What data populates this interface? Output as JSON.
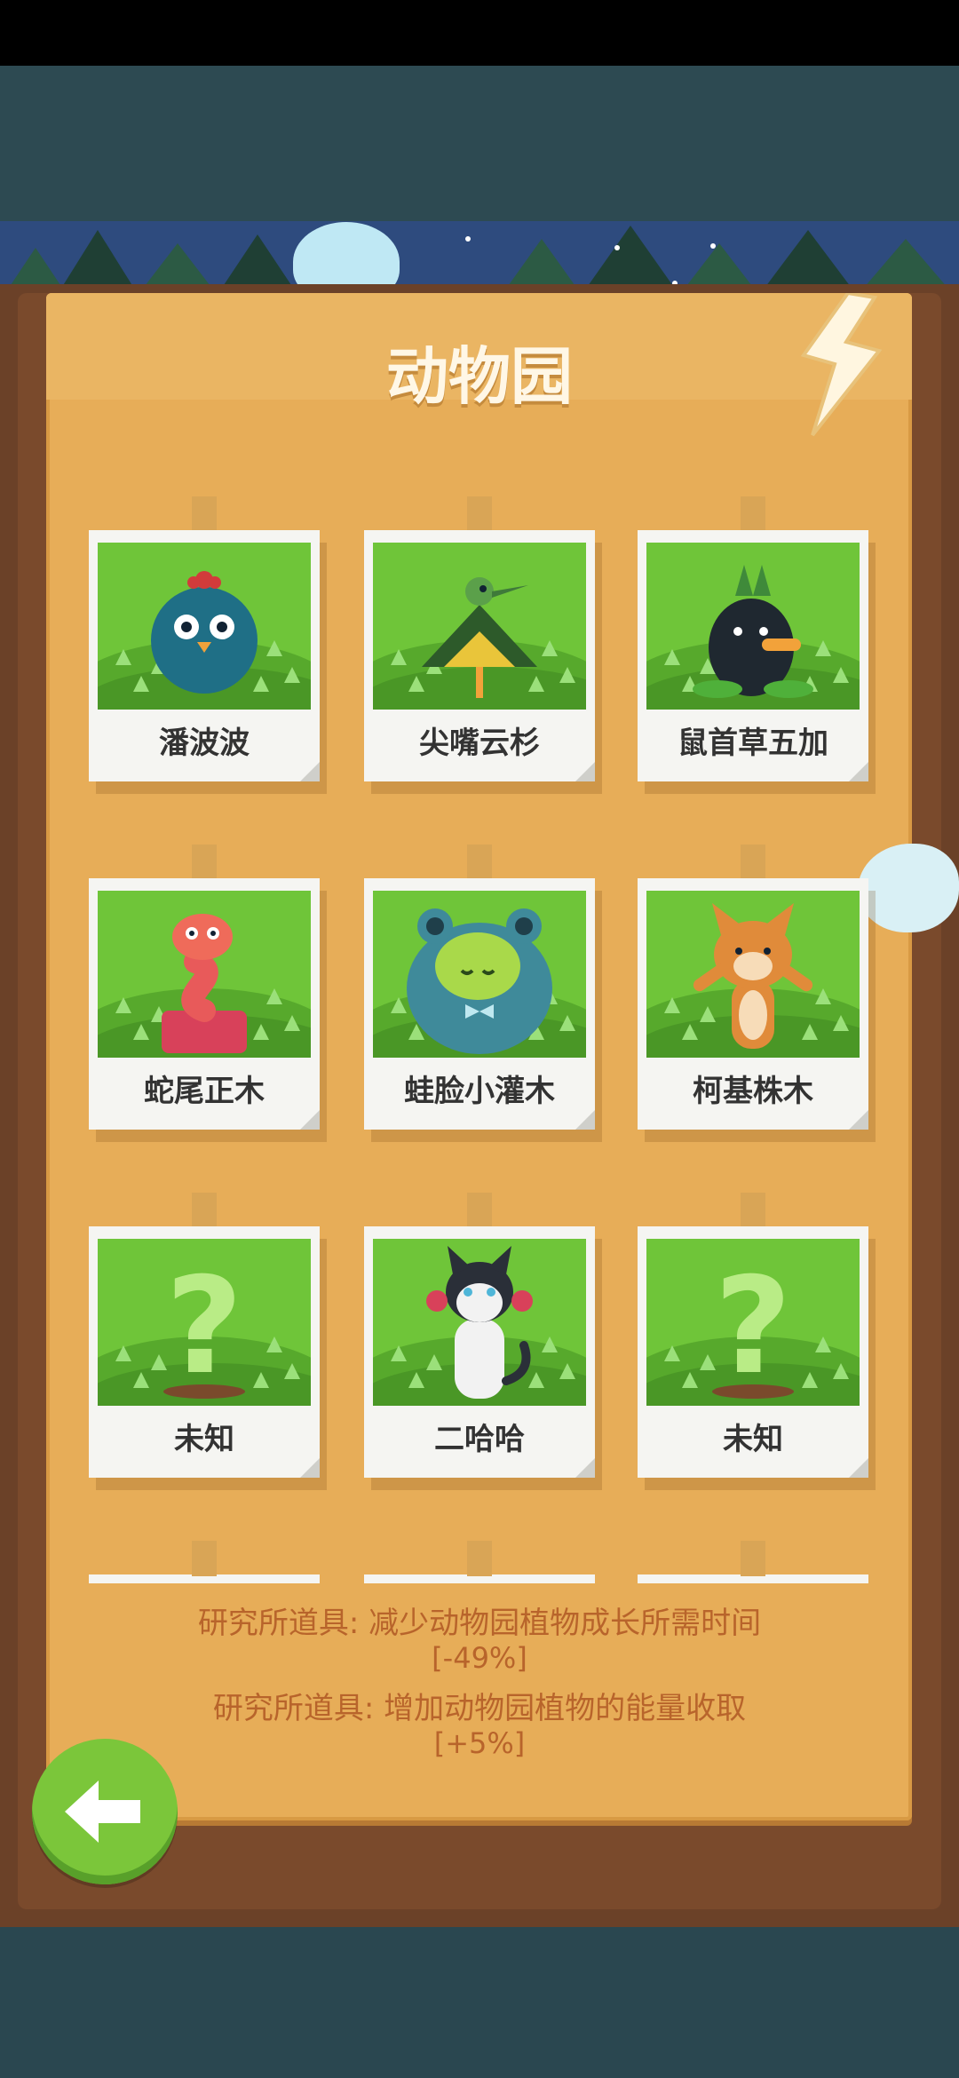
{
  "title": "动物园",
  "cards": [
    {
      "label": "潘波波",
      "creature": "blue-bird"
    },
    {
      "label": "尖嘴云杉",
      "creature": "spruce-bird"
    },
    {
      "label": "鼠首草五加",
      "creature": "mole-plant"
    },
    {
      "label": "蛇尾正木",
      "creature": "snake-plant"
    },
    {
      "label": "蛙脸小灌木",
      "creature": "frog-bush"
    },
    {
      "label": "柯基株木",
      "creature": "corgi-tree"
    },
    {
      "label": "未知",
      "creature": "unknown"
    },
    {
      "label": "二哈哈",
      "creature": "husky"
    },
    {
      "label": "未知",
      "creature": "unknown"
    }
  ],
  "info": {
    "line1": "研究所道具: 减少动物园植物成长所需时间",
    "value1": "[-49%]",
    "line2": "研究所道具: 增加动物园植物的能量收取",
    "value2": "[+5%]"
  },
  "icons": {
    "back": "back-arrow-icon",
    "corner": "lightning-icon"
  },
  "colors": {
    "board": "#e7ad58",
    "info_text": "#b8642b",
    "back_button": "#7bc63a",
    "grass": "#6fc539"
  }
}
